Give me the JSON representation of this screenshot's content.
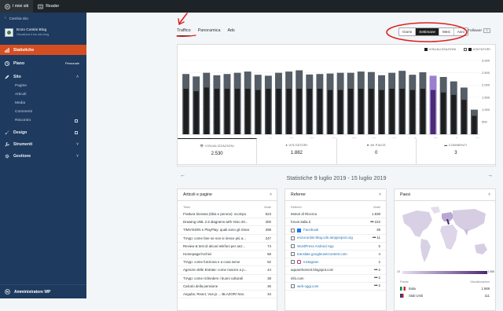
{
  "topbar": {
    "my_sites": "I miei siti",
    "reader": "Reader"
  },
  "sidebar": {
    "back": "Cambia sito",
    "site_name": "Enzo Contini Blog",
    "site_url": "Visualizza il tuo sito blog",
    "items": {
      "stats": "Statistiche",
      "plan": "Piano",
      "plan_badge": "Personale",
      "site": "Sito",
      "pages": "Pagine",
      "articles": "Articoli",
      "media": "Media",
      "comments": "Commenti",
      "reconnect": "Riscontro",
      "design": "Design",
      "tools": "Strumenti",
      "manage": "Gestione"
    },
    "footer": "Amministratore WP"
  },
  "tabs": [
    "Traffico",
    "Panoramica",
    "Ads"
  ],
  "period": [
    "Giorni",
    "Settimane",
    "Mesi",
    "Anni"
  ],
  "period_selected": "Settimane",
  "follower_label": "Follower",
  "chart_data": {
    "type": "bar",
    "categories": [
      "feb 4",
      "feb 18",
      "mar 4",
      "mar 18",
      "apr 1",
      "apr 15",
      "apr 29",
      "mag 13",
      "mag 27",
      "giu 10",
      "giu 24",
      "lug 8",
      "lug 22",
      "ago 5",
      "ago 19"
    ],
    "bar_count": 29,
    "series": [
      {
        "name": "VISUALIZZAZIONI",
        "color": "#555d66",
        "values": [
          2450,
          2350,
          2500,
          2400,
          2450,
          2500,
          2550,
          2420,
          2380,
          2500,
          2550,
          2600,
          2430,
          2450,
          2470,
          2500,
          2500,
          2550,
          2530,
          2400,
          2500,
          2580,
          2420,
          2520,
          2380,
          2330,
          2150,
          1900,
          1000
        ]
      },
      {
        "name": "VISITATORI",
        "color": "#1e1e1e",
        "values": [
          1850,
          1750,
          1900,
          1850,
          1850,
          1850,
          1850,
          1800,
          1850,
          1850,
          1850,
          1850,
          1850,
          1850,
          1800,
          1800,
          1850,
          1850,
          1850,
          1800,
          1850,
          1850,
          1800,
          1850,
          1800,
          1700,
          1600,
          1400,
          750
        ]
      }
    ],
    "highlight_index": 24,
    "highlight_color": "#9b7fcf",
    "yticks": [
      500,
      1000,
      1500,
      2000,
      2500,
      3000
    ],
    "ylim": [
      0,
      3000
    ]
  },
  "stats": [
    {
      "label": "VISUALIZZAZIONI",
      "value": "2.530",
      "icon": "eye-icon"
    },
    {
      "label": "VISITATORI",
      "value": "1.882",
      "icon": "person-icon"
    },
    {
      "label": "MI PIACE",
      "value": "0",
      "icon": "star-icon"
    },
    {
      "label": "COMMENTI",
      "value": "3",
      "icon": "comment-icon"
    }
  ],
  "period_title": "Statistiche 9 luglio 2019 - 15 luglio 2019",
  "articles": {
    "title": "Articoli e pagine",
    "col_title": "Titolo",
    "col_views": "Visite",
    "rows": [
      {
        "t": "Frattura biossea (tibia e perone): scompo",
        "v": "523"
      },
      {
        "t": "Drawing UML 2.5 diagrams with Visio 20...",
        "v": "300"
      },
      {
        "t": "TIMVISION e PlayPlay: quali sono gli Smar",
        "v": "298"
      },
      {
        "t": "TIApp: come fare se non si riesce più a...",
        "v": "247"
      },
      {
        "t": "Review & test di alcuni telefoni per anz...",
        "v": "74"
      },
      {
        "t": "Homepage/Archivi",
        "v": "58"
      },
      {
        "t": "TIApp: come funziona e a cosa serve",
        "v": "52"
      },
      {
        "t": "Agenzie delle Entrate: come riuscire a p...",
        "v": "44"
      },
      {
        "t": "TIApp: come richiedere i buoni culturali",
        "v": "38"
      },
      {
        "t": "Calcolo della pensione",
        "v": "36"
      },
      {
        "t": "Angular, React, Vue.js ... BLAZOR! Nov.",
        "v": "34"
      }
    ]
  },
  "referrers": {
    "title": "Referrer",
    "col_title": "Referrer",
    "col_views": "Visite",
    "rows": [
      {
        "t": "Motori di Ricerca",
        "v": "1.838",
        "link": false,
        "dots": false
      },
      {
        "t": "forum.italia.it",
        "v": "222",
        "link": false,
        "dots": true
      },
      {
        "t": "Facebook",
        "v": "39",
        "link": true,
        "dots": false,
        "icon": "facebook-icon"
      },
      {
        "t": "enzocontini-blog.cdn.ampproject.org",
        "v": "11",
        "link": true,
        "dots": true
      },
      {
        "t": "WordPress Android App",
        "v": "5",
        "link": true,
        "dots": false
      },
      {
        "t": "translate.googleusercontent.com",
        "v": "4",
        "link": true,
        "dots": false
      },
      {
        "t": "Instagram",
        "v": "2",
        "link": true,
        "dots": false,
        "icon": "instagram-icon"
      },
      {
        "t": "aquarehome3.blogspot.com",
        "v": "2",
        "link": false,
        "dots": true
      },
      {
        "t": "info.com",
        "v": "2",
        "link": false,
        "dots": true
      },
      {
        "t": "web-oggi.com",
        "v": "2",
        "link": true,
        "dots": true
      }
    ]
  },
  "countries": {
    "title": "Paesi",
    "scale_min": "10",
    "scale_max": "1.888",
    "col_country": "Paese",
    "col_views": "Visualizzazioni",
    "rows": [
      {
        "name": "Italia",
        "value": "1.869",
        "flag": [
          "#009246",
          "#ffffff",
          "#ce2b37"
        ]
      },
      {
        "name": "Stati Uniti",
        "value": "111",
        "flag": [
          "#3c3b6e",
          "#b22234",
          "#ffffff"
        ]
      }
    ]
  },
  "colors": {
    "accent": "#d54e21",
    "sidebar": "#1e3a5f",
    "annotation": "#e02020",
    "link": "#2271b1"
  }
}
